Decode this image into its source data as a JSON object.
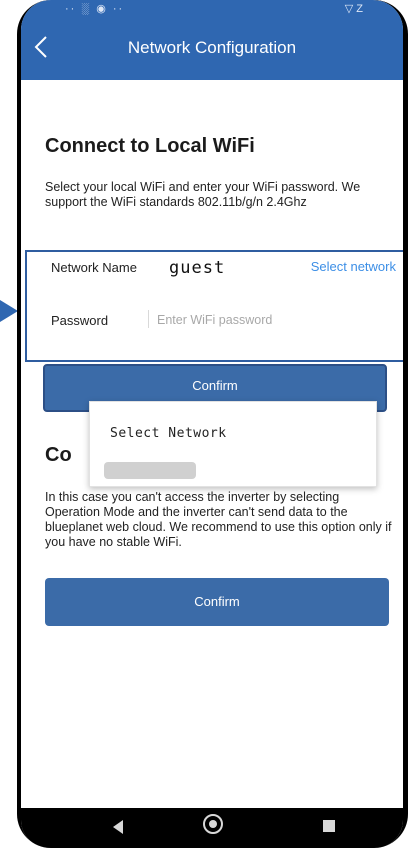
{
  "status_bar": {
    "left": "·· ░ ◉ ··",
    "right": "▽ Z"
  },
  "header": {
    "title": "Network Configuration"
  },
  "local_wifi": {
    "heading": "Connect to Local WiFi",
    "description": "Select your local WiFi and enter your WiFi password. We support the WiFi standards 802.11b/g/n 2.4Ghz",
    "network_label": "Network Name",
    "network_value": "guest",
    "select_link": "Select network",
    "password_label": "Password",
    "password_placeholder": "Enter WiFi password",
    "password_value": "",
    "confirm_label": "Confirm"
  },
  "popup": {
    "title": "Select Network"
  },
  "offline": {
    "heading": "Co",
    "description": "In this case you can't access the inverter by selecting Operation Mode and the inverter can't send data to the blueplanet web cloud. We recommend to use this option only if you have no stable WiFi.",
    "confirm_label": "Confirm"
  },
  "colors": {
    "accent": "#2f67b1",
    "button": "#3b6ba8",
    "link": "#3d8fe6"
  }
}
